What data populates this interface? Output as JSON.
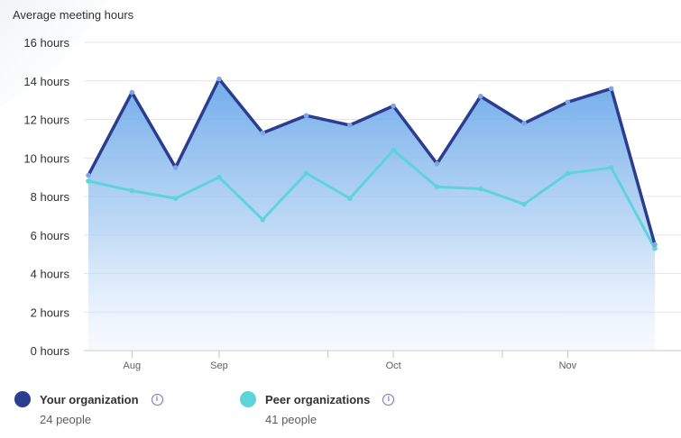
{
  "chart_data": {
    "type": "area",
    "title": "Average meeting hours",
    "ylim": [
      0,
      16
    ],
    "y_ticks": [
      0,
      2,
      4,
      6,
      8,
      10,
      12,
      14,
      16
    ],
    "y_tick_suffix": " hours",
    "x_tick_labels": [
      "Aug",
      "Sep",
      "Oct",
      "Nov"
    ],
    "x_tick_label_indices": [
      1,
      3,
      7,
      11
    ],
    "x_minor_tick_indices": [
      5.5,
      9.5
    ],
    "grid": true,
    "legend_position": "bottom",
    "series": [
      {
        "name": "Your organization",
        "color": "#2b3d8f",
        "values": [
          9.1,
          13.4,
          9.5,
          14.1,
          11.3,
          12.2,
          11.7,
          12.7,
          9.7,
          13.2,
          11.8,
          12.9,
          13.6,
          5.5
        ]
      },
      {
        "name": "Peer organizations",
        "color": "#5fd3dc",
        "values": [
          8.8,
          8.3,
          7.9,
          9.0,
          6.8,
          9.2,
          7.9,
          10.4,
          8.5,
          8.4,
          7.6,
          9.2,
          9.5,
          5.3
        ]
      }
    ]
  },
  "legend": [
    {
      "label": "Your organization",
      "sub": "24 people",
      "color": "#2b3d8f"
    },
    {
      "label": "Peer organizations",
      "sub": "41 people",
      "color": "#5fd3dc"
    }
  ]
}
